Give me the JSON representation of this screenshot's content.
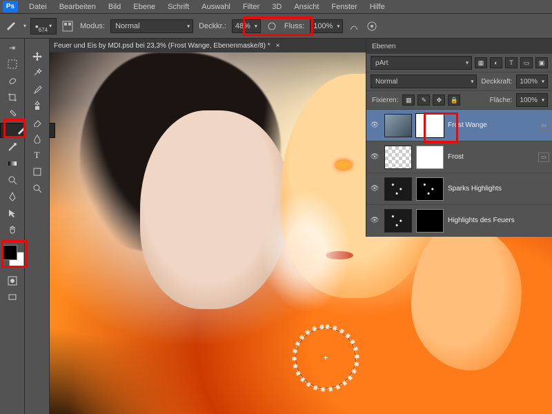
{
  "menu": {
    "items": [
      "Datei",
      "Bearbeiten",
      "Bild",
      "Ebene",
      "Schrift",
      "Auswahl",
      "Filter",
      "3D",
      "Ansicht",
      "Fenster",
      "Hilfe"
    ]
  },
  "options": {
    "brush_size": "674",
    "mode_label": "Modus:",
    "mode_value": "Normal",
    "opacity_label": "Deckkr.:",
    "opacity_value": "48%",
    "flow_label": "Fluss:",
    "flow_value": "100%"
  },
  "tab": {
    "title": "Feuer und Eis by MDI.psd bei 23,3% (Frost Wange, Ebenenmaske/8) *"
  },
  "layers_panel": {
    "title": "Ebenen",
    "filter": "Art",
    "blend": "Normal",
    "opacity_label": "Deckkraft:",
    "opacity_value": "100%",
    "lock_label": "Fixieren:",
    "fill_label": "Fläche:",
    "fill_value": "100%",
    "layers": [
      {
        "name": "Frost Wange",
        "mask": "white",
        "thumb": "frost",
        "selected": true
      },
      {
        "name": "Frost",
        "mask": "white",
        "thumb": "checker",
        "selected": false
      },
      {
        "name": "Sparks Highlights",
        "mask": "black",
        "thumb": "sparks",
        "selected": false
      },
      {
        "name": "Highlights des Feuers",
        "mask": "black",
        "thumb": "sparks",
        "selected": false
      }
    ]
  },
  "colors": {
    "fg": "#000000",
    "bg": "#ffffff",
    "accent": "#ff0000"
  }
}
